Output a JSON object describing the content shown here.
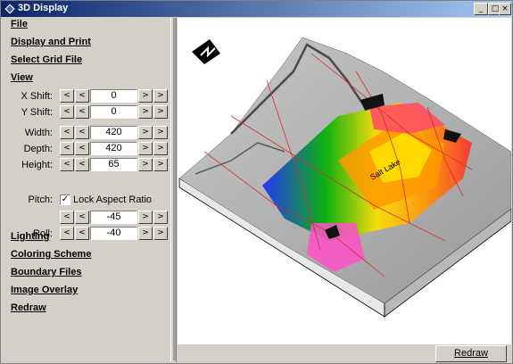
{
  "window": {
    "title": "3D Display"
  },
  "title_buttons": {
    "minimize": "_",
    "maximize": "□",
    "close": "×"
  },
  "menu": {
    "file": "File",
    "display_print": "Display and Print",
    "select_grid": "Select Grid File",
    "view": "View",
    "lighting": "Lighting",
    "coloring": "Coloring Scheme",
    "boundary": "Boundary Files",
    "image_overlay": "Image Overlay",
    "redraw": "Redraw"
  },
  "spin_glyphs": {
    "first": "<",
    "prev": "<",
    "next": ">",
    "last": ">"
  },
  "view_controls": [
    {
      "label": "X Shift:",
      "value": "0"
    },
    {
      "label": "Y Shift:",
      "value": "0"
    },
    {
      "label": "Width:",
      "value": "420"
    },
    {
      "label": "Depth:",
      "value": "420"
    },
    {
      "label": "Height:",
      "value": "65"
    },
    {
      "label": "Pitch:",
      "value": "-45"
    },
    {
      "label": "Roll:",
      "value": "-40"
    }
  ],
  "lock_aspect": {
    "label": "Lock Aspect Ratio",
    "checked": true,
    "mark": "✓"
  },
  "viewport": {
    "map_label": "Salt Lake"
  },
  "footer": {
    "redraw_button": "Redraw"
  },
  "colors": {
    "title_start": "#0a246a",
    "title_end": "#a6caf0",
    "face": "#d4d0c8"
  }
}
